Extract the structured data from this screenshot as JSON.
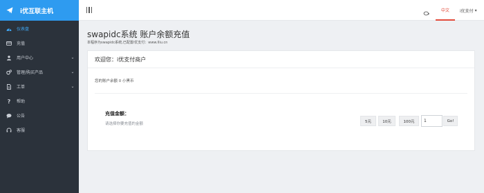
{
  "brand": {
    "name": "i优互联主机"
  },
  "sidebar": {
    "items": [
      {
        "label": "仪表盘",
        "icon": "dashboard-icon",
        "active": true
      },
      {
        "label": "充值",
        "icon": "card-icon"
      },
      {
        "label": "用户中心",
        "icon": "user-icon",
        "has_submenu": true
      },
      {
        "label": "管理/购买产品",
        "icon": "cogs-icon",
        "has_submenu": true
      },
      {
        "label": "工单",
        "icon": "file-icon",
        "has_submenu": true
      },
      {
        "label": "帮助",
        "icon": "question-icon"
      },
      {
        "label": "公告",
        "icon": "comment-icon"
      },
      {
        "label": "客服",
        "icon": "headset-icon"
      }
    ]
  },
  "topbar": {
    "lang_label": "中文",
    "user_label": "i优支付"
  },
  "page": {
    "title": "swapidc系统 账户余额充值",
    "subtitle": "本程序为swapidc系统,已配置i优支付：www.lliu.cn"
  },
  "panel": {
    "welcome": "欢迎您：i优支付商户",
    "balance": "您的账户余额 0 小黑币",
    "recharge_title": "充值金额：",
    "recharge_hint": "请选择你要充值的金额",
    "amount_buttons": [
      "5元",
      "10元",
      "100元"
    ],
    "amount_value": "1",
    "go_label": "Go!"
  },
  "colors": {
    "sidebar_bg": "#2b323b",
    "brand_bg": "#2e9bf0",
    "active": "#3fa3ef",
    "lang_accent": "#e24b3a"
  }
}
